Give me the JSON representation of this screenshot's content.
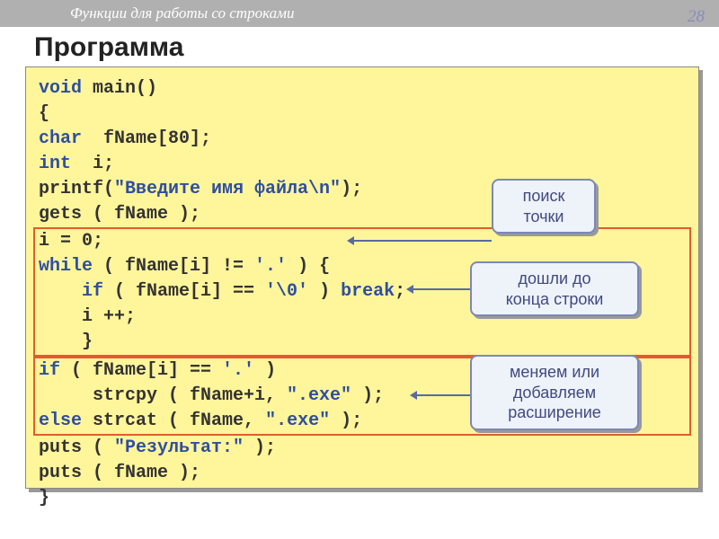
{
  "header": {
    "breadcrumb": "Функции для работы со строками",
    "page_number": "28"
  },
  "title": "Программа",
  "code": {
    "line1a": "void",
    "line1b": " main()",
    "line2": "{",
    "line3a": "char",
    "line3b": "  fName[80];",
    "line4a": "int",
    "line4b": "  i;",
    "line5a": "printf(",
    "line5b": "\"Введите имя файла\\n\"",
    "line5c": ");",
    "line6": "gets ( fName );",
    "line7": "i = 0;",
    "line8a": "while",
    "line8b": " ( fName[i] != ",
    "line8c": "'.'",
    "line8d": " ) {",
    "line9a": "    if",
    "line9b": " ( fName[i] == ",
    "line9c": "'\\0'",
    "line9d": " ) ",
    "line9e": "break",
    "line9f": ";",
    "line10": "    i ++;",
    "line11": "    }",
    "line12a": "if",
    "line12b": " ( fName[i] == ",
    "line12c": "'.'",
    "line12d": " )",
    "line13a": "     strcpy ( fName+i, ",
    "line13b": "\".exe\"",
    "line13c": " );",
    "line14a": "else",
    "line14b": " strcat ( fName, ",
    "line14c": "\".exe\"",
    "line14d": " );",
    "line15a": "puts ( ",
    "line15b": "\"Результат:\"",
    "line15c": " );",
    "line16": "puts ( fName );",
    "line17": "}"
  },
  "callouts": {
    "c1": "поиск\nточки",
    "c2": "дошли до\nконца строки",
    "c3": "меняем или\nдобавляем\nрасширение"
  }
}
